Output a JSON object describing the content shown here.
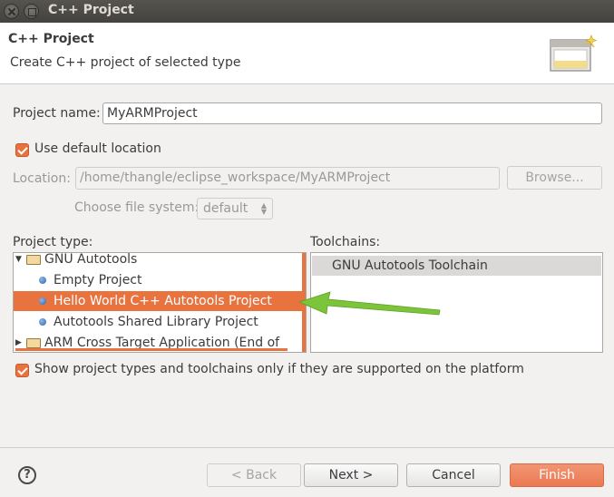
{
  "window": {
    "title": "C++ Project"
  },
  "header": {
    "title": "C++ Project",
    "subtitle": "Create C++ project of selected type"
  },
  "project_name": {
    "label": "Project name:",
    "value": "MyARMProject"
  },
  "use_default_location": {
    "label": "Use default location",
    "checked": true
  },
  "location": {
    "label": "Location:",
    "value": "/home/thangle/eclipse_workspace/MyARMProject",
    "browse_label": "Browse..."
  },
  "file_system": {
    "label": "Choose file system:",
    "value": "default"
  },
  "project_type": {
    "label": "Project type:",
    "items": [
      {
        "label": "GNU Autotools",
        "kind": "folder",
        "expanded": true
      },
      {
        "label": "Empty Project",
        "kind": "leaf"
      },
      {
        "label": "Hello World C++ Autotools Project",
        "kind": "leaf",
        "selected": true
      },
      {
        "label": "Autotools Shared Library Project",
        "kind": "leaf"
      },
      {
        "label": "ARM Cross Target Application (End of life)",
        "kind": "folder",
        "expanded": false
      }
    ]
  },
  "toolchains": {
    "label": "Toolchains:",
    "items": [
      "GNU Autotools Toolchain"
    ]
  },
  "show_supported": {
    "label": "Show project types and toolchains only if they are supported on the platform",
    "checked": true
  },
  "buttons": {
    "help": "?",
    "back": "< Back",
    "next": "Next >",
    "cancel": "Cancel",
    "finish": "Finish"
  },
  "colors": {
    "accent": "#e8733f",
    "annotation_arrow": "#7cc43a"
  }
}
